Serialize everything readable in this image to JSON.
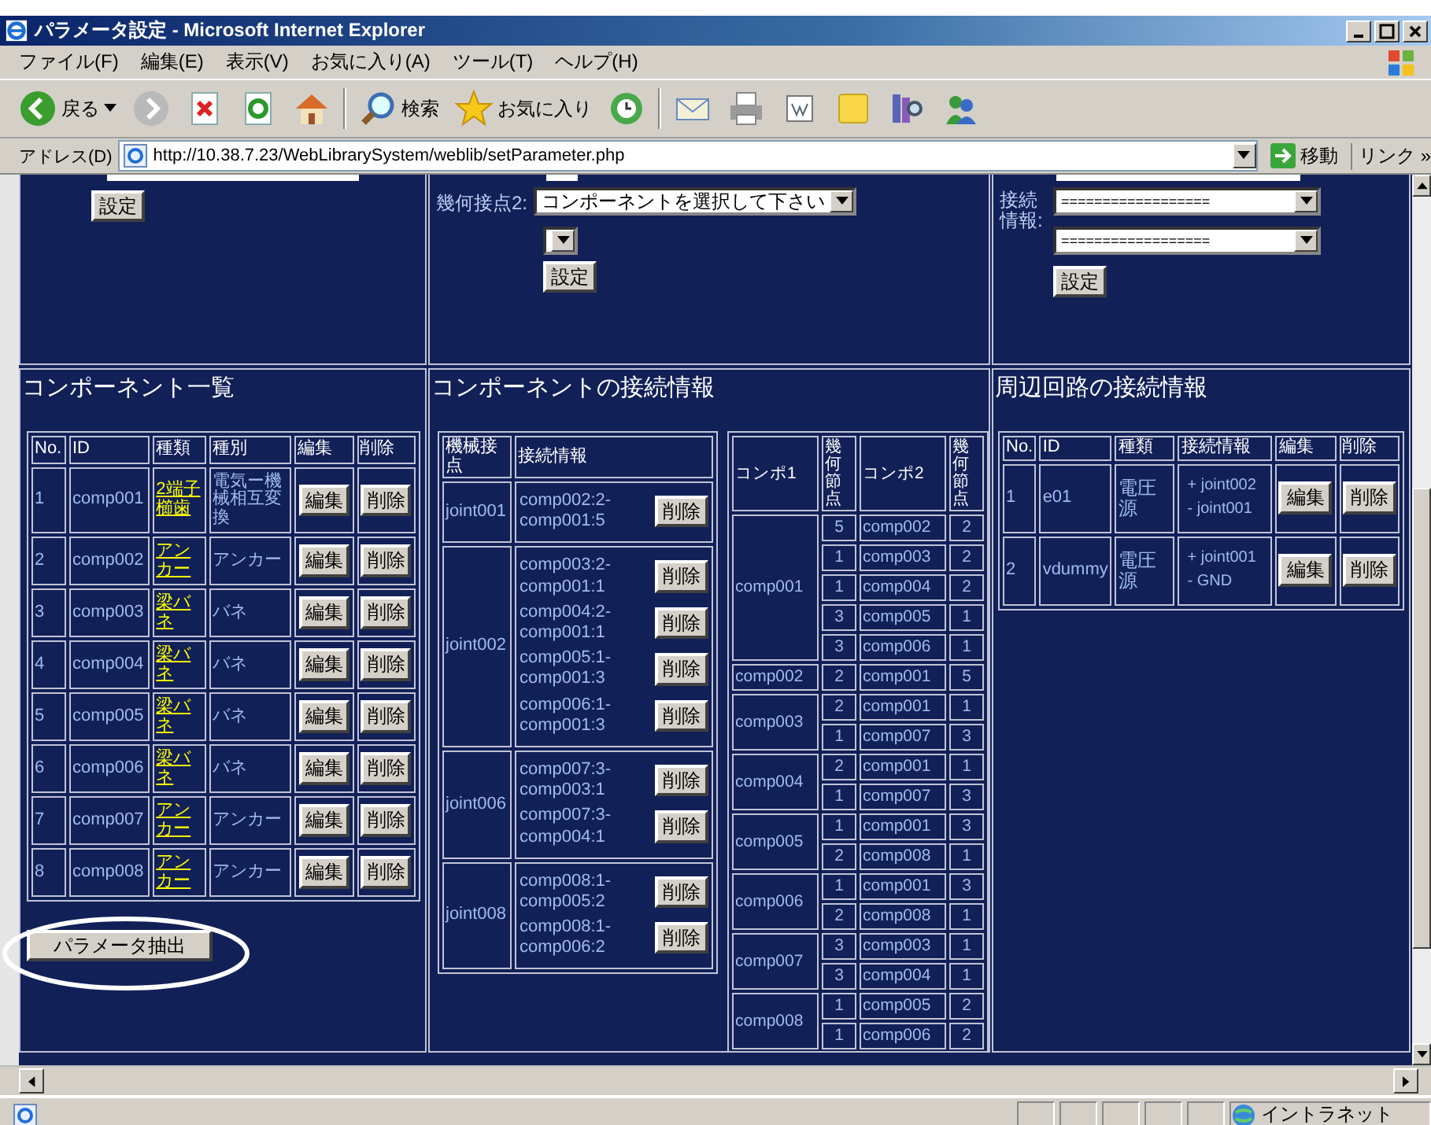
{
  "window": {
    "title": "パラメータ設定 - Microsoft Internet Explorer"
  },
  "menu": [
    "ファイル(F)",
    "編集(E)",
    "表示(V)",
    "お気に入り(A)",
    "ツール(T)",
    "ヘルプ(H)"
  ],
  "toolbar": {
    "back": "戻る",
    "search": "検索",
    "favorites": "お気に入り"
  },
  "address": {
    "label": "アドレス(D)",
    "url": "http://10.38.7.23/WebLibrarySystem/weblib/setParameter.php",
    "go": "移動",
    "links": "リンク »"
  },
  "top_left": {
    "button": "設定"
  },
  "top_middle": {
    "label": "幾何接点2:",
    "select": "コンポーネントを選択して下さい",
    "button": "設定"
  },
  "top_right": {
    "label": "接続情報:",
    "selects": [
      "==================",
      "=================="
    ],
    "button": "設定"
  },
  "components": {
    "title": "コンポーネント一覧",
    "columns": [
      "No.",
      "ID",
      "種類",
      "種別",
      "編集",
      "削除"
    ],
    "rows": [
      {
        "no": "1",
        "id": "comp001",
        "type": "2端子櫛歯",
        "category": "電気ー機械相互変換",
        "edit": "編集",
        "delete": "削除"
      },
      {
        "no": "2",
        "id": "comp002",
        "type": "アンカー",
        "category": "アンカー",
        "edit": "編集",
        "delete": "削除"
      },
      {
        "no": "3",
        "id": "comp003",
        "type": "梁バネ",
        "category": "バネ",
        "edit": "編集",
        "delete": "削除"
      },
      {
        "no": "4",
        "id": "comp004",
        "type": "梁バネ",
        "category": "バネ",
        "edit": "編集",
        "delete": "削除"
      },
      {
        "no": "5",
        "id": "comp005",
        "type": "梁バネ",
        "category": "バネ",
        "edit": "編集",
        "delete": "削除"
      },
      {
        "no": "6",
        "id": "comp006",
        "type": "梁バネ",
        "category": "バネ",
        "edit": "編集",
        "delete": "削除"
      },
      {
        "no": "7",
        "id": "comp007",
        "type": "アンカー",
        "category": "アンカー",
        "edit": "編集",
        "delete": "削除"
      },
      {
        "no": "8",
        "id": "comp008",
        "type": "アンカー",
        "category": "アンカー",
        "edit": "編集",
        "delete": "削除"
      }
    ]
  },
  "extract_button": "パラメータ抽出",
  "connections": {
    "title": "コンポーネントの接続情報",
    "joint_columns": [
      "機械接点",
      "接続情報"
    ],
    "joints": [
      {
        "id": "joint001",
        "links": [
          {
            "text": "comp002:2-comp001:5",
            "button": "削除"
          }
        ]
      },
      {
        "id": "joint002",
        "links": [
          {
            "text": "comp003:2-comp001:1",
            "button": "削除"
          },
          {
            "text": "comp004:2-comp001:1",
            "button": "削除"
          },
          {
            "text": "comp005:1-comp001:3",
            "button": "削除"
          },
          {
            "text": "comp006:1-comp001:3",
            "button": "削除"
          }
        ]
      },
      {
        "id": "joint006",
        "links": [
          {
            "text": "comp007:3-comp003:1",
            "button": "削除"
          },
          {
            "text": "comp007:3-comp004:1",
            "button": "削除"
          }
        ]
      },
      {
        "id": "joint008",
        "links": [
          {
            "text": "comp008:1-comp005:2",
            "button": "削除"
          },
          {
            "text": "comp008:1-comp006:2",
            "button": "削除"
          }
        ]
      }
    ],
    "pair_columns": [
      "コンポ1",
      "幾何節点",
      "コンポ2",
      "幾何節点"
    ],
    "pairs": [
      {
        "comp": "comp001",
        "rows": [
          [
            "5",
            "comp002",
            "2"
          ],
          [
            "1",
            "comp003",
            "2"
          ],
          [
            "1",
            "comp004",
            "2"
          ],
          [
            "3",
            "comp005",
            "1"
          ],
          [
            "3",
            "comp006",
            "1"
          ]
        ]
      },
      {
        "comp": "comp002",
        "rows": [
          [
            "2",
            "comp001",
            "5"
          ]
        ]
      },
      {
        "comp": "comp003",
        "rows": [
          [
            "2",
            "comp001",
            "1"
          ],
          [
            "1",
            "comp007",
            "3"
          ]
        ]
      },
      {
        "comp": "comp004",
        "rows": [
          [
            "2",
            "comp001",
            "1"
          ],
          [
            "1",
            "comp007",
            "3"
          ]
        ]
      },
      {
        "comp": "comp005",
        "rows": [
          [
            "1",
            "comp001",
            "3"
          ],
          [
            "2",
            "comp008",
            "1"
          ]
        ]
      },
      {
        "comp": "comp006",
        "rows": [
          [
            "1",
            "comp001",
            "3"
          ],
          [
            "2",
            "comp008",
            "1"
          ]
        ]
      },
      {
        "comp": "comp007",
        "rows": [
          [
            "3",
            "comp003",
            "1"
          ],
          [
            "3",
            "comp004",
            "1"
          ]
        ]
      },
      {
        "comp": "comp008",
        "rows": [
          [
            "1",
            "comp005",
            "2"
          ],
          [
            "1",
            "comp006",
            "2"
          ]
        ]
      }
    ]
  },
  "peripheral": {
    "title": "周辺回路の接続情報",
    "columns": [
      "No.",
      "ID",
      "種類",
      "接続情報",
      "編集",
      "削除"
    ],
    "rows": [
      {
        "no": "1",
        "id": "e01",
        "type": "電圧源",
        "connections": [
          "+ joint002",
          "- joint001"
        ],
        "edit": "編集",
        "delete": "削除"
      },
      {
        "no": "2",
        "id": "vdummy",
        "type": "電圧源",
        "connections": [
          "+ joint001",
          "- GND"
        ],
        "edit": "編集",
        "delete": "削除"
      }
    ]
  },
  "status_bar": {
    "zone": "イントラネット"
  }
}
